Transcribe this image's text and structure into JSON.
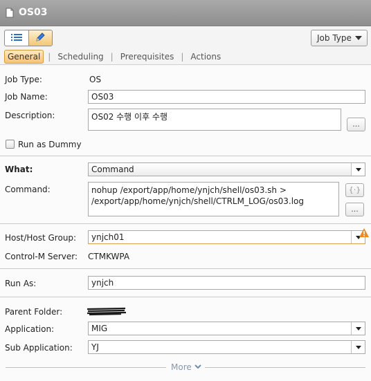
{
  "window": {
    "title": "OS03"
  },
  "toolbar": {
    "view_list_icon": "list-icon",
    "view_edit_icon": "pencil-icon",
    "job_type_button": "Job Type"
  },
  "tabs": [
    {
      "label": "General",
      "active": true
    },
    {
      "label": "Scheduling",
      "active": false
    },
    {
      "label": "Prerequisites",
      "active": false
    },
    {
      "label": "Actions",
      "active": false
    }
  ],
  "general": {
    "job_type_label": "Job Type:",
    "job_type_value": "OS",
    "job_name_label": "Job Name:",
    "job_name_value": "OS03",
    "description_label": "Description:",
    "description_value": "OS02 수행 이후 수행",
    "description_button": "...",
    "run_as_dummy_label": "Run as Dummy",
    "run_as_dummy_checked": false
  },
  "what": {
    "label": "What:",
    "value": "Command",
    "command_label": "Command:",
    "command_value": "nohup /export/app/home/ynjch/shell/os03.sh > /export/app/home/ynjch/shell/CTRLM_LOG/os03.log",
    "variables_icon": "variables-icon",
    "command_button": "..."
  },
  "host": {
    "host_label": "Host/Host Group:",
    "host_value": "ynjch01",
    "warning_icon": "warning-icon",
    "server_label": "Control-M Server:",
    "server_value": "CTMKWPA"
  },
  "run_as": {
    "label": "Run As:",
    "value": "ynjch"
  },
  "folder": {
    "parent_label": "Parent Folder:",
    "application_label": "Application:",
    "application_value": "MIG",
    "sub_application_label": "Sub Application:",
    "sub_application_value": "YJ"
  },
  "footer": {
    "more_label": "More"
  },
  "colors": {
    "titlebar": "#9a9a9a",
    "accent_orange": "#f3c776",
    "warning": "#f08a1c"
  }
}
